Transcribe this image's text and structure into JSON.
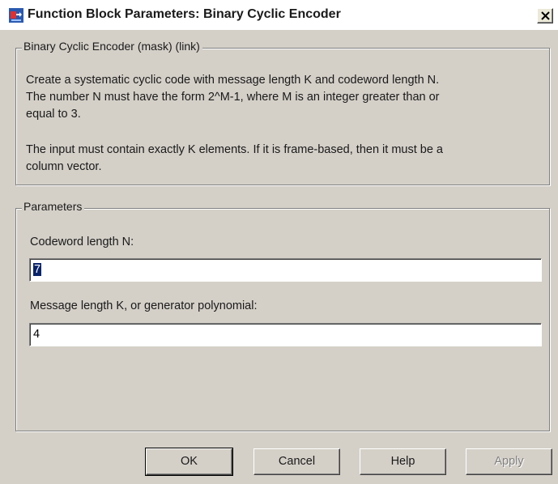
{
  "window": {
    "title": "Function Block Parameters: Binary Cyclic Encoder"
  },
  "description_group": {
    "legend": "Binary Cyclic Encoder (mask) (link)",
    "paragraph1_line1": "Create a systematic cyclic code with message length K and codeword length N.",
    "paragraph1_line2": "The number N must have the form 2^M-1, where M is an integer greater than or",
    "paragraph1_line3": "equal to 3.",
    "paragraph2_line1": "The input must contain exactly K elements.  If it is frame-based, then it must be a",
    "paragraph2_line2": "column vector."
  },
  "parameters_group": {
    "legend": "Parameters",
    "codeword_label": "Codeword length N:",
    "codeword_value": "7",
    "message_label": "Message length K, or generator polynomial:",
    "message_value": "4"
  },
  "buttons": {
    "ok": "OK",
    "cancel": "Cancel",
    "help": "Help",
    "apply": "Apply"
  },
  "icons": {
    "app": "simulink-block-icon",
    "close": "close-icon"
  },
  "colors": {
    "dialog_bg": "#d4d0c8",
    "selection_bg": "#0a246a"
  }
}
